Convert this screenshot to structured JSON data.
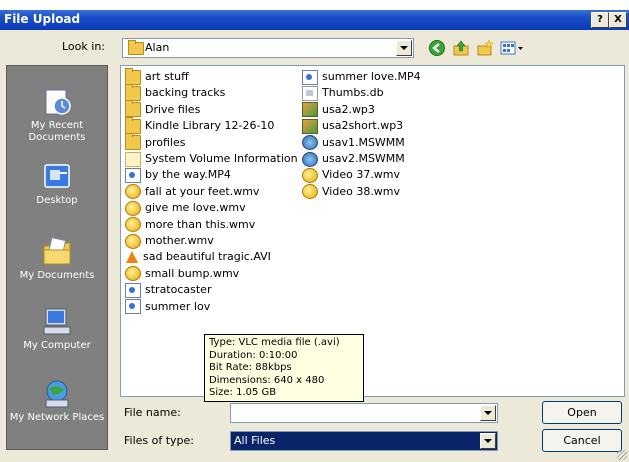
{
  "window": {
    "title": "File Upload",
    "help_label": "?",
    "close_label": "X"
  },
  "lookin": {
    "label": "Look in:",
    "value": "Alan"
  },
  "toolbar": {
    "icons": [
      "back-icon",
      "up-folder-icon",
      "new-folder-icon",
      "view-menu-icon"
    ]
  },
  "places": [
    {
      "label": "My Recent Documents",
      "icon": "recent-documents-icon"
    },
    {
      "label": "Desktop",
      "icon": "desktop-icon"
    },
    {
      "label": "My Documents",
      "icon": "my-documents-icon"
    },
    {
      "label": "My Computer",
      "icon": "my-computer-icon"
    },
    {
      "label": "My Network Places",
      "icon": "network-places-icon"
    }
  ],
  "files": {
    "col1": [
      {
        "name": "art stuff",
        "type": "folder"
      },
      {
        "name": "backing tracks",
        "type": "folder"
      },
      {
        "name": "Drive files",
        "type": "folder"
      },
      {
        "name": "Kindle Library 12-26-10",
        "type": "folder"
      },
      {
        "name": "profiles",
        "type": "folder"
      },
      {
        "name": "System Volume Information",
        "type": "sys"
      },
      {
        "name": "by the way.MP4",
        "type": "mp4"
      },
      {
        "name": "fall at your feet.wmv",
        "type": "wmv"
      },
      {
        "name": "give me love.wmv",
        "type": "wmv"
      },
      {
        "name": "more than this.wmv",
        "type": "wmv"
      },
      {
        "name": "mother.wmv",
        "type": "wmv"
      },
      {
        "name": "sad beautiful tragic.AVI",
        "type": "vlc"
      },
      {
        "name": "small bump.wmv",
        "type": "wmv"
      },
      {
        "name": "stratocaster",
        "type": "mp4"
      },
      {
        "name": "summer lov",
        "type": "mp4"
      }
    ],
    "col2": [
      {
        "name": "summer love.MP4",
        "type": "mp4"
      },
      {
        "name": "Thumbs.db",
        "type": "db"
      },
      {
        "name": "usa2.wp3",
        "type": "wp3"
      },
      {
        "name": "usa2short.wp3",
        "type": "wp3"
      },
      {
        "name": "usav1.MSWMM",
        "type": "mswmm"
      },
      {
        "name": "usav2.MSWMM",
        "type": "mswmm"
      },
      {
        "name": "Video 37.wmv",
        "type": "wmv"
      },
      {
        "name": "Video 38.wmv",
        "type": "wmv"
      }
    ]
  },
  "tooltip": {
    "type": "Type: VLC media file (.avi)",
    "duration": "Duration: 0:10:00",
    "bitrate": "Bit Rate: 88kbps",
    "dimensions": "Dimensions: 640 x 480",
    "size": "Size: 1.05 GB"
  },
  "filename": {
    "label": "File name:",
    "value": ""
  },
  "filetype": {
    "label": "Files of type:",
    "value": "All Files"
  },
  "buttons": {
    "open": "Open",
    "cancel": "Cancel"
  }
}
